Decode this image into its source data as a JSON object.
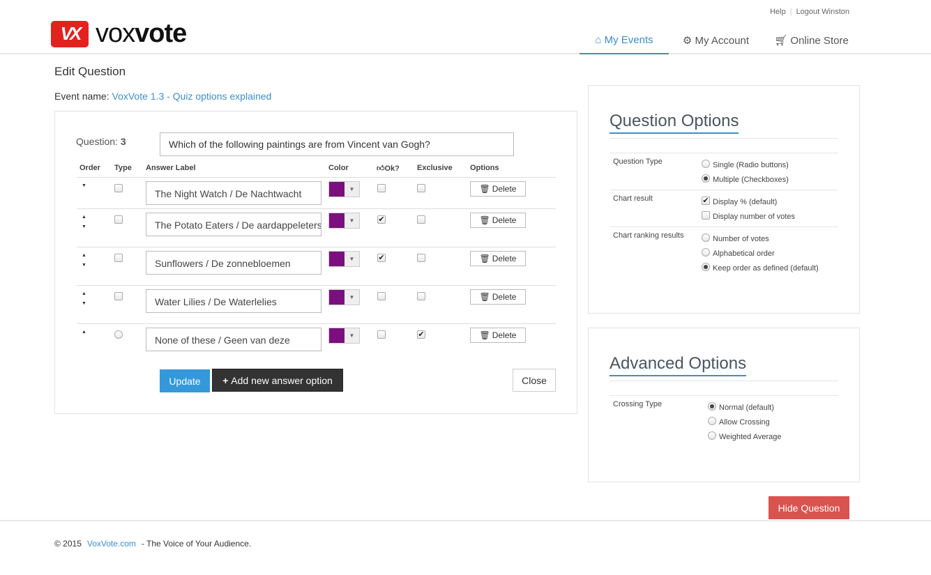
{
  "header": {
    "logo_text": "voxvote",
    "help": "Help",
    "logout": "Logout Winston",
    "nav": [
      {
        "label": "My Events",
        "icon": "home-icon",
        "active": true
      },
      {
        "label": "My Account",
        "icon": "gear-icon"
      },
      {
        "label": "Online Store",
        "icon": "cart-icon"
      }
    ]
  },
  "page": {
    "title": "Edit Question",
    "event_label": "Event name:",
    "event_name": "VoxVote 1.3 - Quiz options explained"
  },
  "question": {
    "label": "Question:",
    "number": "3",
    "text": "Which of the following paintings are from Vincent van Gogh?"
  },
  "table": {
    "headers": [
      "Order",
      "Type",
      "Answer Label",
      "Color",
      "Ok?",
      "Exclusive",
      "Options"
    ],
    "rows": [
      {
        "label": "The Night Watch / De Nachtwacht",
        "up": false,
        "down": true,
        "type": "checkbox",
        "ok": false,
        "exclusive": false,
        "color": "#7b0f7e"
      },
      {
        "label": "The Potato Eaters / De aardappeleters",
        "up": true,
        "down": true,
        "type": "checkbox",
        "ok": true,
        "exclusive": false,
        "color": "#7b0f7e"
      },
      {
        "label": "Sunflowers / De zonnebloemen",
        "up": true,
        "down": true,
        "type": "checkbox",
        "ok": true,
        "exclusive": false,
        "color": "#7b0f7e"
      },
      {
        "label": "Water Lilies / De Waterlelies",
        "up": true,
        "down": true,
        "type": "checkbox",
        "ok": false,
        "exclusive": false,
        "color": "#7b0f7e"
      },
      {
        "label": "None of these / Geen van deze",
        "up": true,
        "down": false,
        "type": "radio",
        "ok": false,
        "exclusive": true,
        "color": "#7b0f7e"
      }
    ],
    "delete_label": "Delete"
  },
  "buttons": {
    "update": "Update",
    "add": "Add new answer option",
    "close": "Close",
    "hide": "Hide Question"
  },
  "question_options": {
    "title": "Question Options",
    "groups": [
      {
        "label": "Question Type",
        "kind": "radio",
        "options": [
          {
            "text": "Single (Radio buttons)",
            "on": false
          },
          {
            "text": "Multiple (Checkboxes)",
            "on": true
          }
        ]
      },
      {
        "label": "Chart result",
        "kind": "checkbox",
        "options": [
          {
            "text": "Display % (default)",
            "on": true
          },
          {
            "text": "Display number of votes",
            "on": false
          }
        ]
      },
      {
        "label": "Chart ranking results",
        "kind": "radio",
        "options": [
          {
            "text": "Number of votes",
            "on": false
          },
          {
            "text": "Alphabetical order",
            "on": false
          },
          {
            "text": "Keep order as defined (default)",
            "on": true
          }
        ]
      }
    ]
  },
  "advanced_options": {
    "title": "Advanced Options",
    "groups": [
      {
        "label": "Crossing Type",
        "kind": "radio",
        "options": [
          {
            "text": "Normal (default)",
            "on": true
          },
          {
            "text": "Allow Crossing",
            "on": false
          },
          {
            "text": "Weighted Average",
            "on": false
          }
        ]
      }
    ]
  },
  "footer": {
    "copyright": "© 2015",
    "link": "VoxVote.com",
    "tagline": "- The Voice of Your Audience."
  },
  "colors": {
    "accent": "#3a8fd0",
    "update": "#3498db",
    "add": "#333333",
    "hide": "#d9534f",
    "logo": "#e3211d"
  }
}
